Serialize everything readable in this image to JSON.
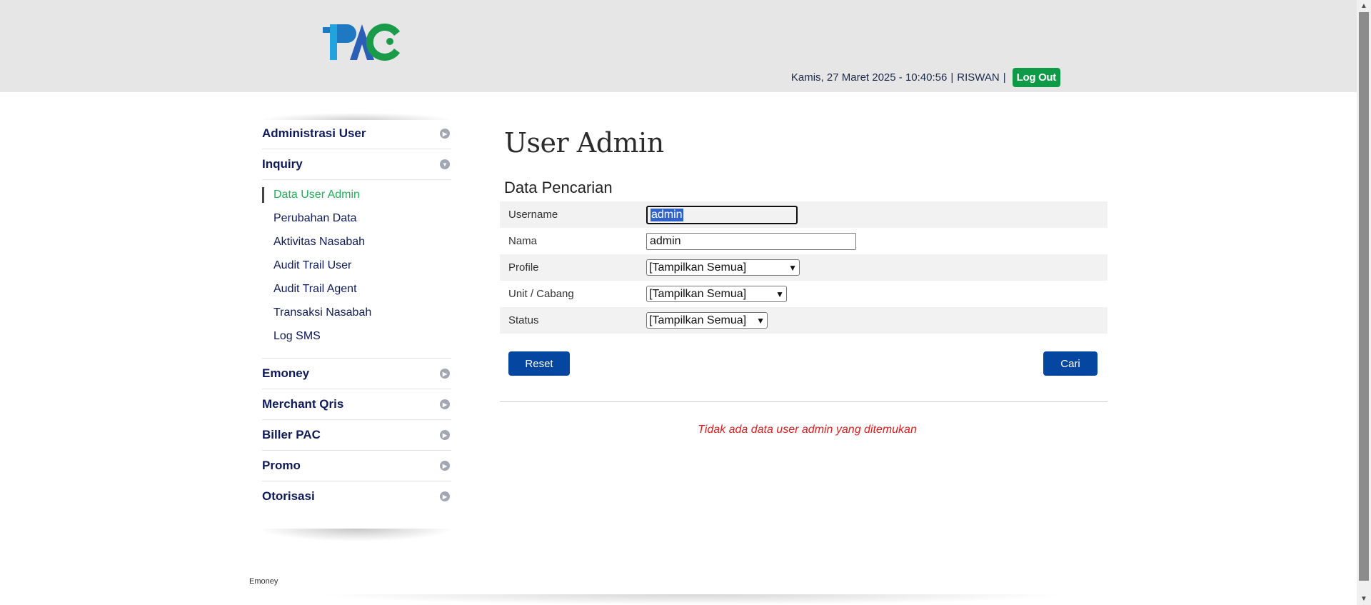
{
  "header": {
    "logo_alt": "PAC",
    "datetime": "Kamis, 27 Maret 2025 - 10:40:56",
    "separator": "|",
    "username": "RISWAN",
    "logout_label": "Log Out"
  },
  "sidebar": {
    "sections": [
      {
        "label": "Administrasi User",
        "icon": "chevron-right-circle-icon"
      },
      {
        "label": "Inquiry",
        "icon": "chevron-down-circle-icon"
      },
      {
        "label": "Emoney",
        "icon": "chevron-right-circle-icon"
      },
      {
        "label": "Merchant Qris",
        "icon": "chevron-right-circle-icon"
      },
      {
        "label": "Biller PAC",
        "icon": "chevron-right-circle-icon"
      },
      {
        "label": "Promo",
        "icon": "chevron-right-circle-icon"
      },
      {
        "label": "Otorisasi",
        "icon": "chevron-right-circle-icon"
      }
    ],
    "inquiry_items": [
      {
        "label": "Data User Admin",
        "active": true
      },
      {
        "label": "Perubahan Data"
      },
      {
        "label": "Aktivitas Nasabah"
      },
      {
        "label": "Audit Trail User"
      },
      {
        "label": "Audit Trail Agent"
      },
      {
        "label": "Transaksi Nasabah"
      },
      {
        "label": "Log SMS"
      }
    ]
  },
  "main": {
    "title": "User Admin",
    "section_title": "Data Pencarian",
    "fields": {
      "username": {
        "label": "Username",
        "value": "admin"
      },
      "nama": {
        "label": "Nama",
        "value": "admin"
      },
      "profile": {
        "label": "Profile",
        "value": "[Tampilkan Semua]"
      },
      "unit": {
        "label": "Unit / Cabang",
        "value": "[Tampilkan Semua]"
      },
      "status": {
        "label": "Status",
        "value": "[Tampilkan Semua]"
      }
    },
    "reset_label": "Reset",
    "search_label": "Cari",
    "empty_message": "Tidak ada data user admin yang ditemukan"
  },
  "footer": {
    "text": "Emoney"
  },
  "colors": {
    "header_bg": "#e7e6e7",
    "logout_green": "#0f9a47",
    "button_blue": "#0546a0",
    "menu_navy": "#0e1a5a",
    "active_green": "#1fb35a",
    "error_red": "#e31b1b"
  }
}
